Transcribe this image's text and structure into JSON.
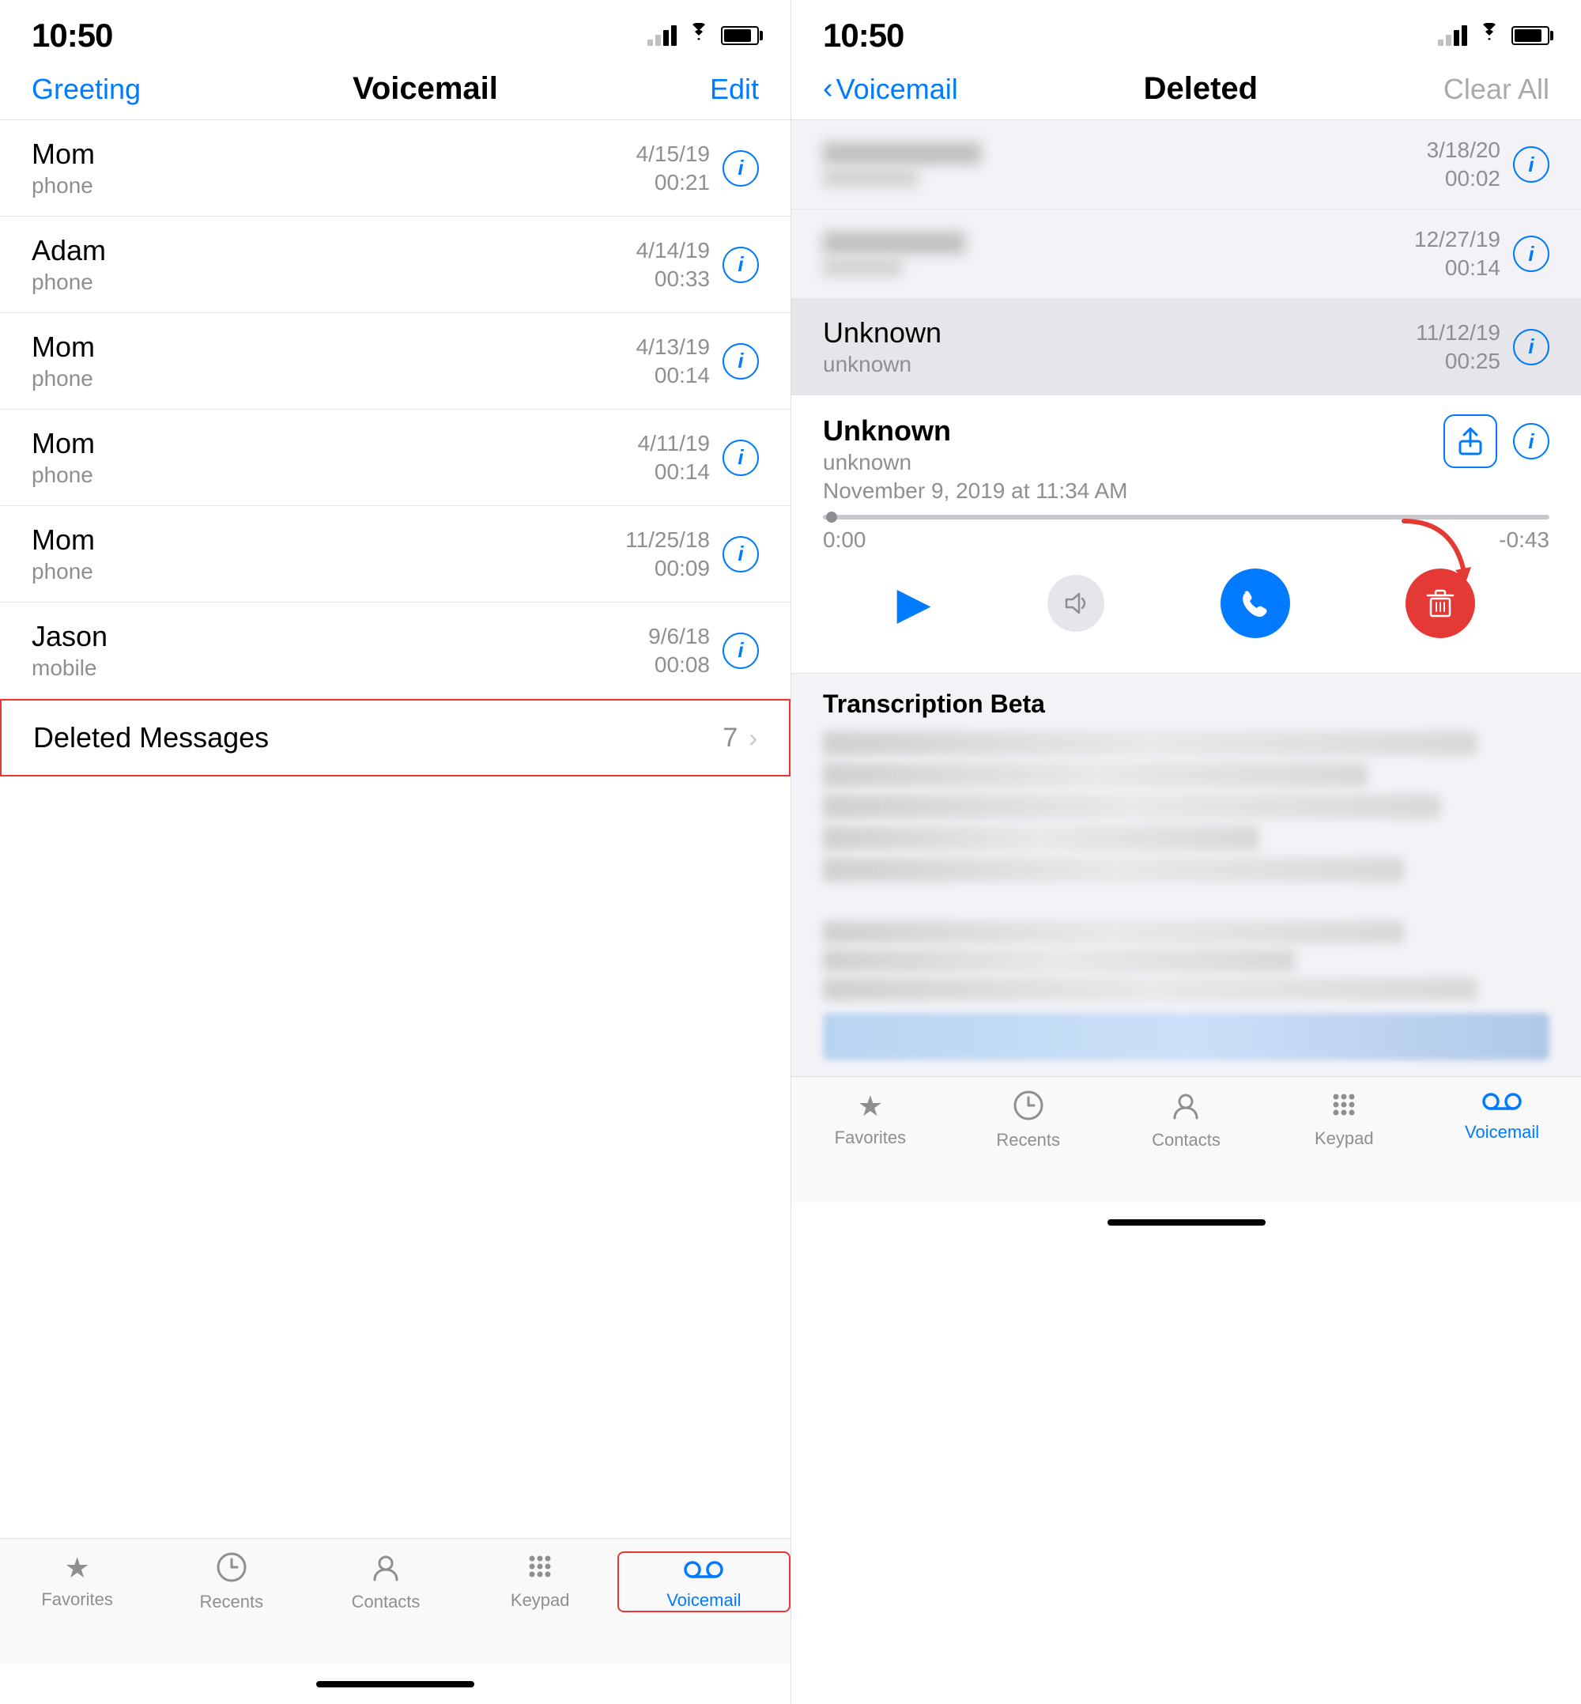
{
  "left_screen": {
    "status_time": "10:50",
    "nav_title": "Voicemail",
    "nav_left": "Greeting",
    "nav_right": "Edit",
    "voicemail_items": [
      {
        "name": "Mom",
        "subtext": "phone",
        "date": "4/15/19",
        "duration": "00:21"
      },
      {
        "name": "Adam",
        "subtext": "phone",
        "date": "4/14/19",
        "duration": "00:33"
      },
      {
        "name": "Mom",
        "subtext": "phone",
        "date": "4/13/19",
        "duration": "00:14"
      },
      {
        "name": "Mom",
        "subtext": "phone",
        "date": "4/11/19",
        "duration": "00:14"
      },
      {
        "name": "Mom",
        "subtext": "phone",
        "date": "11/25/18",
        "duration": "00:09"
      },
      {
        "name": "Jason",
        "subtext": "mobile",
        "date": "9/6/18",
        "duration": "00:08"
      }
    ],
    "deleted_row": {
      "label": "Deleted Messages",
      "count": "7"
    },
    "tab_bar": {
      "items": [
        {
          "id": "favorites",
          "label": "Favorites",
          "icon": "★",
          "active": false
        },
        {
          "id": "recents",
          "label": "Recents",
          "icon": "🕐",
          "active": false
        },
        {
          "id": "contacts",
          "label": "Contacts",
          "icon": "👤",
          "active": false
        },
        {
          "id": "keypad",
          "label": "Keypad",
          "icon": "⠿",
          "active": false
        },
        {
          "id": "voicemail",
          "label": "Voicemail",
          "icon": "vm",
          "active": true
        }
      ]
    }
  },
  "right_screen": {
    "status_time": "10:50",
    "nav_back": "Voicemail",
    "nav_title": "Deleted",
    "nav_right": "Clear All",
    "deleted_items": [
      {
        "blurred": true,
        "date": "3/18/20",
        "duration": "00:02"
      },
      {
        "blurred": true,
        "date": "12/27/19",
        "duration": "00:14"
      },
      {
        "name": "Unknown",
        "subtext": "unknown",
        "date": "11/12/19",
        "duration": "00:25",
        "selected": true
      }
    ],
    "expanded_vm": {
      "name": "Unknown",
      "subtext": "unknown",
      "datetime": "November 9, 2019 at 11:34 AM",
      "time_start": "0:00",
      "time_end": "-0:43"
    },
    "transcription_title": "Transcription Beta",
    "tab_bar": {
      "items": [
        {
          "id": "favorites",
          "label": "Favorites",
          "icon": "★",
          "active": false
        },
        {
          "id": "recents",
          "label": "Recents",
          "icon": "🕐",
          "active": false
        },
        {
          "id": "contacts",
          "label": "Contacts",
          "icon": "👤",
          "active": false
        },
        {
          "id": "keypad",
          "label": "Keypad",
          "icon": "⠿",
          "active": false
        },
        {
          "id": "voicemail",
          "label": "Voicemail",
          "icon": "vm",
          "active": true
        }
      ]
    }
  }
}
